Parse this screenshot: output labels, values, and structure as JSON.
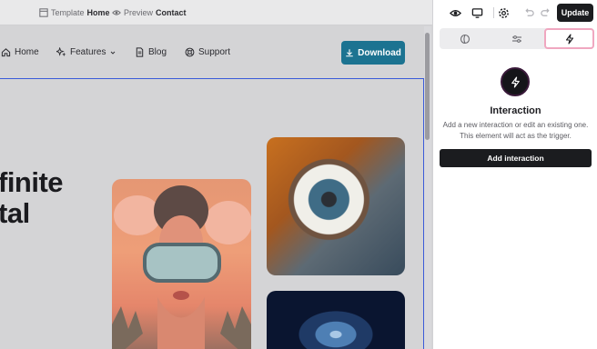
{
  "topbar": {
    "template_prefix": "Template",
    "template_name": "Home",
    "preview_prefix": "Preview",
    "preview_name": "Contact"
  },
  "nav": {
    "items": [
      {
        "label": "Home",
        "icon": "home-icon"
      },
      {
        "label": "Features",
        "icon": "sparkle-icon",
        "has_dropdown": true
      },
      {
        "label": "Blog",
        "icon": "document-icon"
      },
      {
        "label": "Support",
        "icon": "lifebuoy-icon"
      }
    ],
    "download_label": "Download"
  },
  "hero": {
    "line1": "finite",
    "line2": "tal"
  },
  "toolbar": {
    "update_label": "Update",
    "icons": [
      "eye-icon",
      "monitor-icon",
      "gear-icon",
      "undo-icon",
      "redo-icon"
    ]
  },
  "inspector": {
    "tabs": [
      {
        "icon": "style-drop-icon",
        "active": false
      },
      {
        "icon": "sliders-icon",
        "active": false
      },
      {
        "icon": "lightning-icon",
        "active": true
      }
    ],
    "title": "Interaction",
    "description": "Add a new interaction or edit an existing one. This element will act as the trigger.",
    "add_button_label": "Add interaction"
  },
  "colors": {
    "accent": "#1c7391",
    "selection": "#3a5bd9",
    "active_tab_border": "#f0a7c0",
    "dark_button": "#1b1c1f"
  }
}
